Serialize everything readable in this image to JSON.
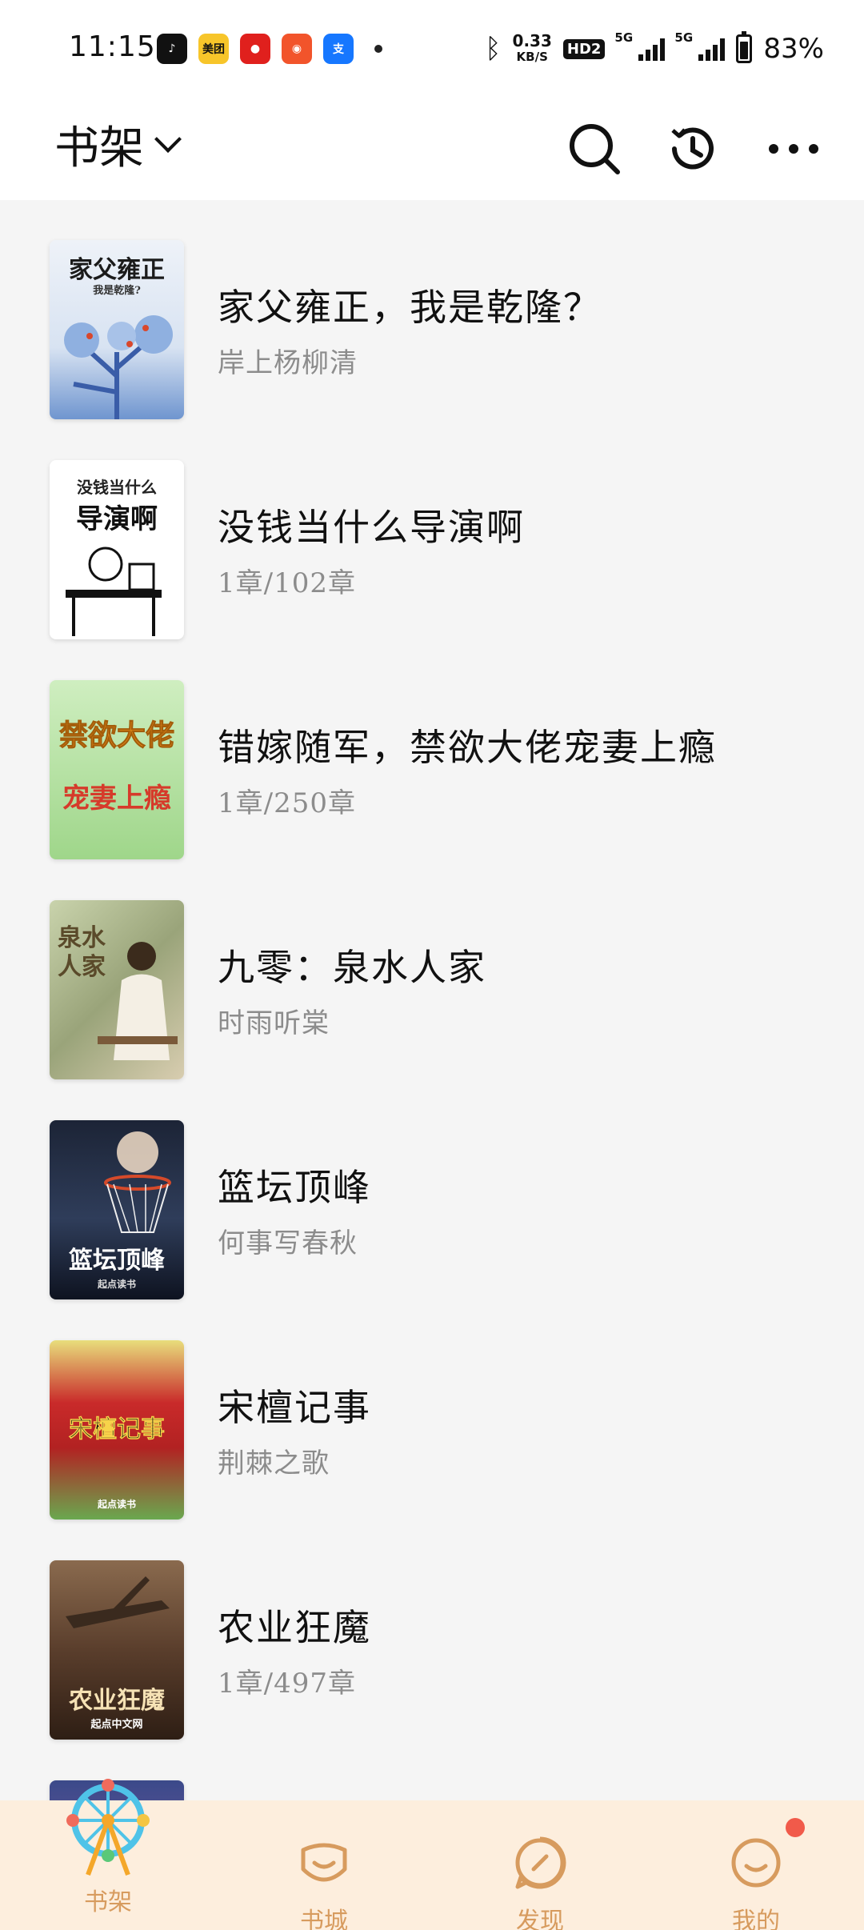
{
  "status_bar": {
    "time": "11:15",
    "notification_icons": [
      "tiktok-icon",
      "meituan-icon",
      "red-app-icon",
      "orange-app-icon",
      "alipay-icon"
    ],
    "net_speed_value": "0.33",
    "net_speed_unit": "KB/S",
    "hd_label": "HD2",
    "signal1_label": "5G",
    "signal2_label": "5G",
    "battery": "83%"
  },
  "header": {
    "title": "书架",
    "icons": [
      "search-icon",
      "history-icon",
      "more-icon"
    ]
  },
  "books": [
    {
      "title": "家父雍正，我是乾隆？",
      "subtitle": "岸上杨柳清",
      "cover_text": "家父雍正",
      "cover_sub": "我是乾隆?",
      "cover_colors": [
        "#eef2f8",
        "#4d7ac4"
      ]
    },
    {
      "title": "没钱当什么导演啊",
      "subtitle": "1章/102章",
      "cover_text": "导演啊",
      "cover_sub": "没钱当什么",
      "cover_colors": [
        "#ffffff",
        "#222222"
      ]
    },
    {
      "title": "错嫁随军，禁欲大佬宠妻上瘾",
      "subtitle": "1章/250章",
      "cover_text": "禁欲大佬",
      "cover_sub": "宠妻上瘾",
      "cover_colors": [
        "#b9e3a4",
        "#e7a63a"
      ]
    },
    {
      "title": "九零：泉水人家",
      "subtitle": "时雨听棠",
      "cover_text": "泉水人家",
      "cover_sub": "",
      "cover_colors": [
        "#b9c59f",
        "#6d5b3e"
      ]
    },
    {
      "title": "篮坛顶峰",
      "subtitle": "何事写春秋",
      "cover_text": "篮坛顶峰",
      "cover_sub": "起点读书",
      "cover_colors": [
        "#2b3a55",
        "#f1f1f1"
      ]
    },
    {
      "title": "宋檀记事",
      "subtitle": "荆棘之歌",
      "cover_text": "宋檀记事",
      "cover_sub": "起点读书",
      "cover_colors": [
        "#e6dc7a",
        "#c8262a"
      ]
    },
    {
      "title": "农业狂魔",
      "subtitle": "1章/497章",
      "cover_text": "农业狂魔",
      "cover_sub": "起点中文网",
      "cover_colors": [
        "#5a3a28",
        "#f3d6a6"
      ]
    }
  ],
  "tabs": [
    {
      "label": "书架",
      "icon": "ferris-wheel-icon"
    },
    {
      "label": "书城",
      "icon": "bookstore-icon"
    },
    {
      "label": "发现",
      "icon": "compass-icon"
    },
    {
      "label": "我的",
      "icon": "profile-icon"
    }
  ],
  "colors": {
    "tab_bar_bg": "#fdeedd",
    "tab_accent": "#d79b5e",
    "badge": "#f15a4a",
    "subtitle": "#8c8c8c"
  }
}
